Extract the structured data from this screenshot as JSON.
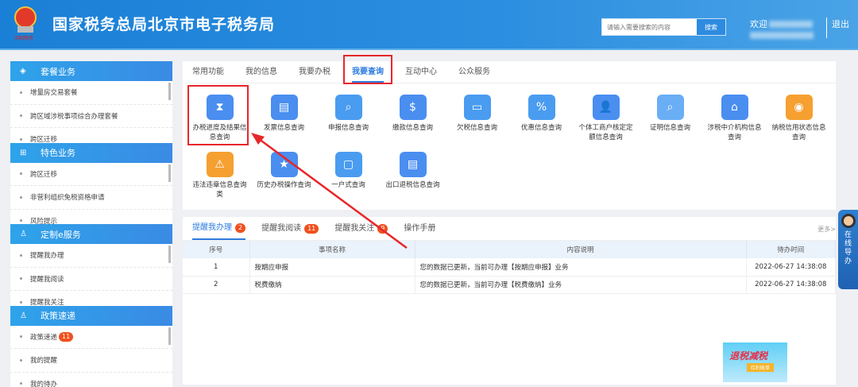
{
  "header": {
    "title": "国家税务总局北京市电子税务局",
    "search_placeholder": "请输入需要搜索的内容",
    "search_button": "搜索",
    "welcome": "欢迎",
    "logout": "退出"
  },
  "sidebar": [
    {
      "title": "套餐业务",
      "icon": "layers-icon",
      "items": [
        "增量房交易套餐",
        "跨区域涉税事项综合办理套餐",
        "跨区迁移"
      ]
    },
    {
      "title": "特色业务",
      "icon": "grid-icon",
      "items": [
        "跨区迁移",
        "非营利组织免税资格申请",
        "风险提示"
      ]
    },
    {
      "title": "定制e服务",
      "icon": "user-icon",
      "items": [
        "提醒我办理",
        "提醒我阅读",
        "提醒我关注"
      ]
    },
    {
      "title": "政策速递",
      "icon": "user-icon",
      "items": [
        "政策速递",
        "我的提醒",
        "我的待办"
      ],
      "badge": "11"
    }
  ],
  "main": {
    "tabs": [
      "常用功能",
      "我的信息",
      "我要办税",
      "我要查询",
      "互动中心",
      "公众服务"
    ],
    "functions": [
      {
        "label": "办税进度及结果信息查询",
        "icon": "hourglass-icon",
        "color": "#4a8ef0"
      },
      {
        "label": "发票信息查询",
        "icon": "invoice-search-icon",
        "color": "#4a8ef0"
      },
      {
        "label": "申报信息查询",
        "icon": "browser-search-icon",
        "color": "#4a9cf0"
      },
      {
        "label": "缴款信息查询",
        "icon": "money-bag-icon",
        "color": "#4a8ef0"
      },
      {
        "label": "欠税信息查询",
        "icon": "card-search-icon",
        "color": "#4a9cf0"
      },
      {
        "label": "优惠信息查询",
        "icon": "discount-tag-icon",
        "color": "#4a9cf0"
      },
      {
        "label": "个体工商户核定定额信息查询",
        "icon": "person-doc-icon",
        "color": "#4a8ef0"
      },
      {
        "label": "证明信息查询",
        "icon": "document-search-icon",
        "color": "#6aaef5"
      },
      {
        "label": "涉税中介机构信息查询",
        "icon": "house-person-icon",
        "color": "#4a8ef0"
      },
      {
        "label": "纳税信用状态信息查询",
        "icon": "medal-icon",
        "color": "#f5a030"
      },
      {
        "label": "违法违章信息查询类",
        "icon": "warning-hand-icon",
        "color": "#f5a030"
      },
      {
        "label": "历史办税操作查询",
        "icon": "star-badge-icon",
        "color": "#4a8ef0"
      },
      {
        "label": "一户式查询",
        "icon": "monitor-cursor-icon",
        "color": "#4a9cf0"
      },
      {
        "label": "出口退税信息查询",
        "icon": "receipt-search-icon",
        "color": "#4a8ef0"
      }
    ]
  },
  "reminders": {
    "tabs": [
      {
        "label": "提醒我办理",
        "badge": "2"
      },
      {
        "label": "提醒我阅读",
        "badge": "11"
      },
      {
        "label": "提醒我关注",
        "badge": "9"
      },
      {
        "label": "操作手册"
      }
    ],
    "more": "更多>",
    "columns": [
      "序号",
      "事项名称",
      "内容说明",
      "待办时间"
    ],
    "rows": [
      [
        "1",
        "按期应申报",
        "您的数据已更新，当前可办理【按期应申报】业务",
        "2022-06-27 14:38:08"
      ],
      [
        "2",
        "税费缴纳",
        "您的数据已更新，当前可办理【税费缴纳】业务",
        "2022-06-27 14:38:08"
      ]
    ],
    "banner_title": "退税减税",
    "banner_sub": "红利账单"
  },
  "guide": {
    "chars": [
      "在",
      "线",
      "导",
      "办"
    ]
  }
}
